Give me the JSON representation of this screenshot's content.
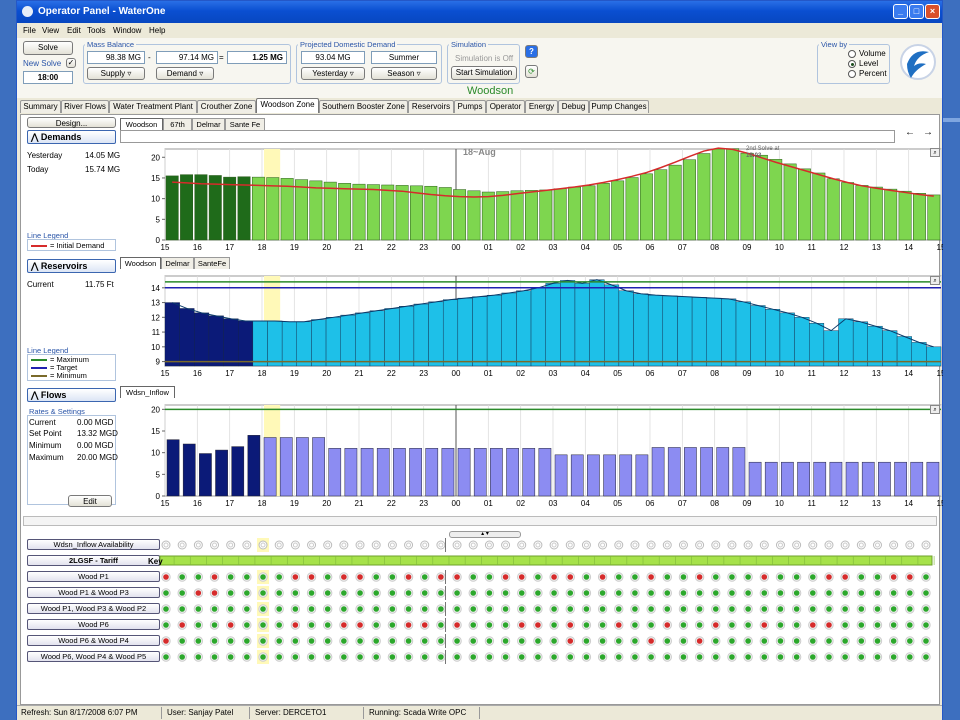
{
  "window": {
    "title": "Operator Panel - WaterOne"
  },
  "menu": [
    "File",
    "View",
    "Edit",
    "Tools",
    "Window",
    "Help"
  ],
  "toolbar": {
    "solve_label": "Solve",
    "new_solve_label": "New Solve",
    "solve_time": "18:00",
    "mass_balance": {
      "title": "Mass Balance",
      "a": "98.38 MG",
      "minus": "-",
      "b": "97.14 MG",
      "equals": "=",
      "result": "1.25 MG",
      "supply_label": "Supply",
      "demand_label": "Demand"
    },
    "projected": {
      "title": "Projected Domestic Demand",
      "value": "93.04 MG",
      "season": "Summer",
      "yesterday_label": "Yesterday",
      "season_label": "Season"
    },
    "simulation": {
      "title": "Simulation",
      "status": "Simulation is Off",
      "start_label": "Start Simulation"
    },
    "viewby": {
      "title": "View by",
      "options": [
        "Volume",
        "Level",
        "Percent"
      ],
      "selected": "Level"
    }
  },
  "zone_title": "Woodson",
  "tabs": [
    "Summary",
    "River Flows",
    "Water Treatment Plant",
    "Crouther Zone",
    "Woodson Zone",
    "Southern Booster Zone",
    "Reservoirs",
    "Pumps",
    "Operator",
    "Energy",
    "Debug",
    "Pump Changes"
  ],
  "active_tab": "Woodson Zone",
  "demands": {
    "design_label": "Design...",
    "section_label": "Demands",
    "yesterday_label": "Yesterday",
    "yesterday_value": "14.05 MG",
    "today_label": "Today",
    "today_value": "15.74 MG",
    "legend_title": "Line Legend",
    "legend_items": [
      "= Initial Demand"
    ],
    "subtabs": [
      "Woodson",
      "67th",
      "Delmar",
      "Sante Fe"
    ],
    "date_label": "18~Aug",
    "solve_note_1": "2nd Solve at",
    "solve_note_2": "18:03",
    "nav_prev": "←",
    "nav_next": "→"
  },
  "reservoirs": {
    "section_label": "Reservoirs",
    "current_label": "Current",
    "current_value": "11.75 Ft",
    "legend_title": "Line Legend",
    "legend_items": [
      "= Maximum",
      "= Target",
      "= Minimum"
    ],
    "subtabs": [
      "Woodson",
      "Delmar",
      "SanteFe"
    ]
  },
  "flows": {
    "section_label": "Flows",
    "rates_title": "Rates & Settings",
    "rows": [
      {
        "label": "Current",
        "value": "0.00 MGD"
      },
      {
        "label": "Set Point",
        "value": "13.32 MGD"
      },
      {
        "label": "Minimum",
        "value": "0.00 MGD"
      },
      {
        "label": "Maximum",
        "value": "20.00 MGD"
      }
    ],
    "edit_label": "Edit",
    "subtabs": [
      "Wdsn_Inflow"
    ]
  },
  "x_ticks": [
    "15",
    "16",
    "17",
    "18",
    "19",
    "20",
    "21",
    "22",
    "23",
    "00",
    "01",
    "02",
    "03",
    "04",
    "05",
    "06",
    "07",
    "08",
    "09",
    "10",
    "11",
    "12",
    "13",
    "14",
    "15"
  ],
  "chart_data": [
    {
      "type": "bar",
      "name": "Demands",
      "yticks": [
        0,
        5,
        10,
        15,
        20
      ],
      "ylim": [
        0,
        22
      ],
      "values": [
        15.5,
        15.8,
        15.8,
        15.6,
        15.2,
        15.3,
        15.2,
        15.1,
        14.9,
        14.6,
        14.3,
        14.0,
        13.7,
        13.5,
        13.4,
        13.3,
        13.2,
        13.1,
        13.0,
        12.7,
        12.2,
        11.9,
        11.6,
        11.7,
        11.9,
        12.0,
        12.1,
        12.4,
        12.8,
        13.1,
        13.7,
        14.3,
        15.1,
        16.0,
        17.0,
        18.1,
        19.4,
        20.9,
        22.0,
        22.1,
        21.0,
        20.5,
        19.5,
        18.4,
        17.2,
        16.2,
        14.8,
        13.9,
        13.2,
        12.8,
        12.3,
        11.8,
        11.3,
        10.9
      ],
      "series": [
        {
          "name": "Initial Demand",
          "values": [
            14,
            13.8,
            13.6,
            13.5,
            13.4,
            13.3,
            13.2,
            13.1,
            13.0,
            12.8,
            12.6,
            12.5,
            12.4,
            12.3,
            12.2,
            12.0,
            11.8,
            11.4,
            11.0,
            10.7,
            10.5,
            10.4,
            10.5,
            10.8,
            11.2,
            11.6,
            12.0,
            12.4,
            12.8,
            13.3,
            13.9,
            14.6,
            15.4,
            16.3,
            17.5,
            18.8,
            20.2,
            21.5,
            22.2,
            21.9,
            21.0,
            19.9,
            18.8,
            17.8,
            16.8,
            15.8,
            14.8,
            13.9,
            13.1,
            12.5,
            12.0,
            11.5,
            11.0,
            10.6
          ]
        }
      ]
    },
    {
      "type": "area",
      "name": "Reservoirs",
      "yticks": [
        9,
        10,
        11,
        12,
        13,
        14
      ],
      "ylim": [
        8.7,
        14.8
      ],
      "maximum": 14.4,
      "target": 14.0,
      "minimum": 9.0,
      "values": [
        13.0,
        12.6,
        12.3,
        12.1,
        11.9,
        11.75,
        11.75,
        11.75,
        11.7,
        11.7,
        11.85,
        12.0,
        12.15,
        12.3,
        12.45,
        12.6,
        12.75,
        12.9,
        13.05,
        13.2,
        13.3,
        13.4,
        13.5,
        13.65,
        13.8,
        14.0,
        14.3,
        14.5,
        14.3,
        14.55,
        14.2,
        13.8,
        13.6,
        13.5,
        13.45,
        13.4,
        13.35,
        13.3,
        13.25,
        13.05,
        12.8,
        12.55,
        12.3,
        12.0,
        11.6,
        11.1,
        11.9,
        11.7,
        11.4,
        11.1,
        10.7,
        10.3,
        10.0
      ]
    },
    {
      "type": "bar",
      "name": "Flows",
      "yticks": [
        0,
        5,
        10,
        15,
        20
      ],
      "ylim": [
        0,
        21
      ],
      "maximum": 20,
      "values": [
        13.0,
        12.0,
        9.8,
        10.6,
        11.4,
        14.0,
        13.5,
        13.5,
        13.5,
        13.5,
        11.0,
        11.0,
        11.0,
        11.0,
        11.0,
        11.0,
        11.0,
        11.0,
        11.0,
        11.0,
        11.0,
        11.0,
        11.0,
        11.0,
        9.5,
        9.5,
        9.5,
        9.5,
        9.5,
        9.5,
        11.2,
        11.2,
        11.2,
        11.2,
        11.2,
        11.2,
        7.8,
        7.8,
        7.8,
        7.8,
        7.8,
        7.8,
        7.8,
        7.8,
        7.8,
        7.8,
        7.8,
        7.8
      ]
    }
  ],
  "schedule": {
    "key_label": "Key",
    "rows": [
      {
        "label": "Wdsn_Inflow Availability",
        "pattern": "E"
      },
      {
        "label": "2LGSF - Tariff",
        "pattern": "T"
      },
      {
        "label": "Wood P1",
        "pattern": "RGGRGGGGRRGRRGGRGRRGGRRGRRGRGGRGGRGGGRGGGRRGGRRGGR"
      },
      {
        "label": "Wood P1 & Wood P3",
        "pattern": "GGRRGGGGGGGGGGGGGGGGGGGGGGGGGGGGGGGGGGGGGGGGGGGGGG"
      },
      {
        "label": "Wood P1, Wood P3 & Wood P2",
        "pattern": "GGGGGGGGGGGGGGGGGGGGGGGGGGGGGGGGGGGGGGGGGGGGGGGGGG"
      },
      {
        "label": "Wood P6",
        "pattern": "GRGGRGGGRGGRRGGRRGRGGGRRGRGGRGGRGGRGGRGGRRGGGGGGRG"
      },
      {
        "label": "Wood P6 & Wood P4",
        "pattern": "RGGGGGGGGGGGGGGGGGGGGGGGGRGGGGRGGRGGGGGGGGGGGGGGGG"
      },
      {
        "label": "Wood P6, Wood P4 & Wood P5",
        "pattern": "GGGGGGGGGGGGGGGGGGGGGGGGGGGGGGGGGGGGGGGGGGGGGGGGGG"
      }
    ]
  },
  "status": {
    "refresh": "Refresh: Sun 8/17/2008 6:07 PM",
    "user": "User: Sanjay Patel",
    "server": "Server: DERCETO1",
    "running": "Running: Scada Write OPC"
  },
  "colors": {
    "dark_green": "#1f6b1a",
    "light_green": "#7ed64f",
    "dark_navy": "#0b1a78",
    "light_cyan": "#1ec0e8",
    "periwinkle": "#8c8cf2",
    "highlight": "#fff9b8",
    "red": "#d62b2b"
  }
}
